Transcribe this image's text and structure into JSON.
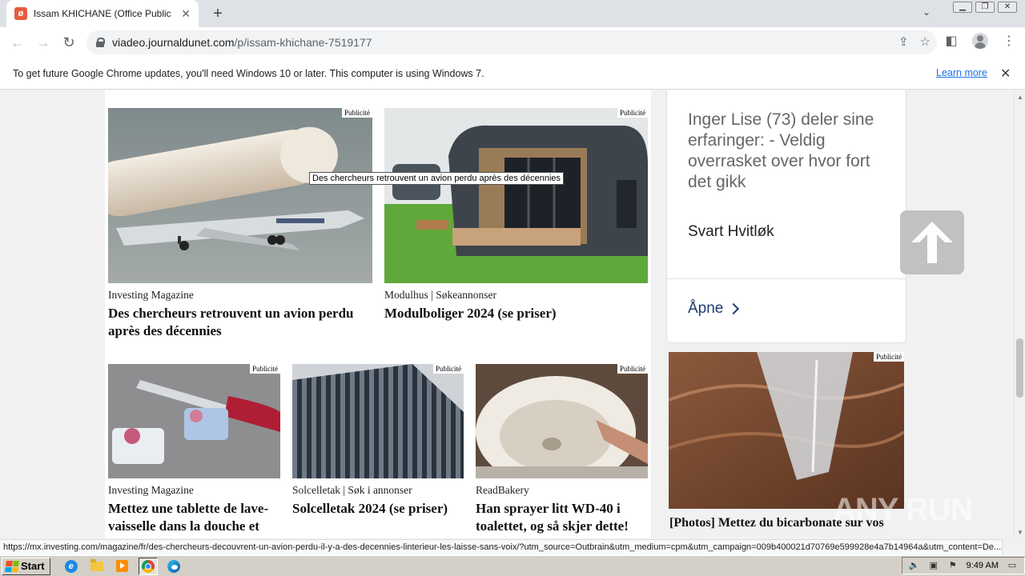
{
  "browser": {
    "tab_title": "Issam KHICHANE (Office Public de Tr",
    "favicon_glyph": "ø",
    "url_host": "viadeo.journaldunet.com",
    "url_path": "/p/issam-khichane-7519177"
  },
  "infobar": {
    "message": "To get future Google Chrome updates, you'll need Windows 10 or later. This computer is using Windows 7.",
    "link": "Learn more"
  },
  "tooltip": "Des chercheurs retrouvent un avion perdu après des décennies",
  "ad_badge": "Publicité",
  "cards": [
    {
      "source": "Investing Magazine",
      "title": "Des chercheurs retrouvent un avion perdu après des décennies"
    },
    {
      "source": "Modulhus | Søkeannonser",
      "title": "Modulboliger 2024 (se priser)"
    },
    {
      "source": "Investing Magazine",
      "title": "Mettez une tablette de lave-vaisselle dans la douche et"
    },
    {
      "source": "Solcelletak | Søk i annonser",
      "title": "Solcelletak 2024 (se priser)"
    },
    {
      "source": "ReadBakery",
      "title": "Han sprayer litt WD-40 i toalettet, og så skjer dette!"
    }
  ],
  "side_ad": {
    "headline": "Inger Lise (73) deler sine erfaringer: - Veldig overrasket over hvor fort det gikk",
    "brand": "Svart Hvitløk",
    "cta": "Åpne"
  },
  "side_card2": {
    "title": "[Photos] Mettez du bicarbonate sur vos"
  },
  "status_url": "https://mx.investing.com/magazine/fr/des-chercheurs-decouvrent-un-avion-perdu-il-y-a-des-decennies-linterieur-les-laisse-sans-voix/?utm_source=Outbrain&utm_medium=cpm&utm_campaign=009b400021d70769e599928e4a7b14964a&utm_content=De...",
  "taskbar": {
    "start_label": "Start",
    "clock": "9:49 AM"
  },
  "watermark": "ANY RUN",
  "colors": {
    "link_blue": "#1a73e8",
    "cta_navy": "#1a3e6e"
  }
}
